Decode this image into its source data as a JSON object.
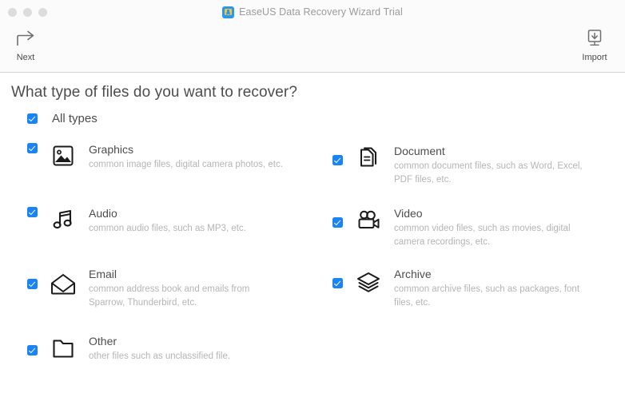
{
  "window": {
    "title": "EaseUS Data Recovery Wizard Trial",
    "app_icon": "easeus-app-icon",
    "traffic_lights": [
      "close",
      "minimize",
      "zoom"
    ]
  },
  "toolbar": {
    "next": {
      "label": "Next",
      "icon": "arrow-turn-right-icon"
    },
    "import": {
      "label": "Import",
      "icon": "import-download-icon"
    }
  },
  "content": {
    "heading": "What type of files do you want to recover?",
    "all_types": {
      "label": "All types",
      "checked": true
    },
    "left_column": [
      {
        "id": "graphics",
        "title": "Graphics",
        "desc": "common image files, digital camera photos, etc.",
        "icon": "image-picture-icon",
        "checked": true
      },
      {
        "id": "audio",
        "title": "Audio",
        "desc": "common audio files, such as MP3, etc.",
        "icon": "music-note-icon",
        "checked": true
      },
      {
        "id": "email",
        "title": "Email",
        "desc": "common address book and emails from Sparrow, Thunderbird, etc.",
        "icon": "envelope-icon",
        "checked": true
      },
      {
        "id": "other",
        "title": "Other",
        "desc": "other files such as unclassified file.",
        "icon": "folder-icon",
        "checked": true
      }
    ],
    "right_column": [
      {
        "id": "document",
        "title": "Document",
        "desc": "common document files, such as Word, Excel, PDF files, etc.",
        "icon": "document-pages-icon",
        "checked": true
      },
      {
        "id": "video",
        "title": "Video",
        "desc": "common video files, such as movies, digital camera recordings, etc.",
        "icon": "video-camera-icon",
        "checked": true
      },
      {
        "id": "archive",
        "title": "Archive",
        "desc": "common archive files, such as packages, font files, etc.",
        "icon": "layers-stack-icon",
        "checked": true
      }
    ]
  },
  "colors": {
    "accent": "#1a84f7",
    "titlebar_bg": "#fbfbfb",
    "text": "#4d4d4d",
    "muted_text": "#b5b5b5"
  }
}
